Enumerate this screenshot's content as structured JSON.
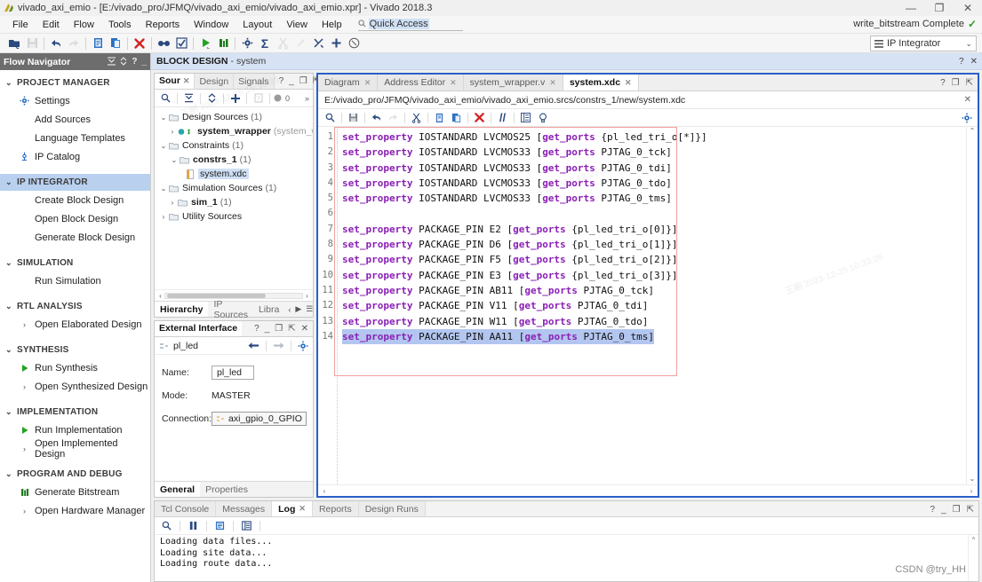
{
  "window": {
    "title": "vivado_axi_emio - [E:/vivado_pro/JFMQ/vivado_axi_emio/vivado_axi_emio.xpr] - Vivado 2018.3",
    "minimize": "—",
    "maximize": "❐",
    "close": "✕"
  },
  "menu": {
    "items": [
      "File",
      "Edit",
      "Flow",
      "Tools",
      "Reports",
      "Window",
      "Layout",
      "View",
      "Help"
    ],
    "quick_access_placeholder": "Quick Access",
    "quick_access_value": "Quick Access",
    "search_icon": "search-icon"
  },
  "status": {
    "text": "write_bitstream Complete",
    "check": "✓",
    "check_color": "#2a9c2a"
  },
  "layout_selector": {
    "value": "IP Integrator",
    "chevron": "⌄",
    "icon": "layout-icon"
  },
  "toolbar": {
    "buttons": [
      {
        "name": "open-project-icon",
        "glyph": "open",
        "disabled": false
      },
      {
        "name": "save-icon",
        "glyph": "save",
        "disabled": true
      },
      {
        "name": "undo-icon",
        "glyph": "undo",
        "disabled": false
      },
      {
        "name": "redo-icon",
        "glyph": "redo",
        "disabled": true
      },
      {
        "name": "copy-icon",
        "glyph": "doc",
        "disabled": false
      },
      {
        "name": "paste-icon",
        "glyph": "paste",
        "disabled": false
      },
      {
        "name": "delete-icon",
        "glyph": "xred",
        "disabled": false
      },
      {
        "name": "search-replace-icon",
        "glyph": "goggles",
        "disabled": false
      },
      {
        "name": "validate-icon",
        "glyph": "check-box",
        "disabled": false
      },
      {
        "name": "run-icon",
        "glyph": "play",
        "disabled": false
      },
      {
        "name": "report-icon",
        "glyph": "bars",
        "disabled": false
      },
      {
        "name": "settings-icon",
        "glyph": "gear",
        "disabled": false
      },
      {
        "name": "sigma-icon",
        "glyph": "sigma",
        "disabled": false
      },
      {
        "name": "cut-icon",
        "glyph": "scissors",
        "disabled": true
      },
      {
        "name": "pencil-icon",
        "glyph": "pencil",
        "disabled": true
      },
      {
        "name": "route-icon",
        "glyph": "route",
        "disabled": false
      },
      {
        "name": "add-icon",
        "glyph": "plus",
        "disabled": false
      },
      {
        "name": "cancel-icon",
        "glyph": "xcircle",
        "disabled": false
      }
    ]
  },
  "flow_navigator": {
    "title": "Flow Navigator",
    "controls": [
      "collapse-all-icon",
      "expand-icon",
      "help-icon",
      "minimize-icon"
    ],
    "groups": [
      {
        "label": "PROJECT MANAGER",
        "selected": false,
        "chevron": "⌄",
        "items": [
          {
            "label": "Settings",
            "icon": "gear-icon"
          },
          {
            "label": "Add Sources",
            "icon": "none"
          },
          {
            "label": "Language Templates",
            "icon": "none"
          },
          {
            "label": "IP Catalog",
            "icon": "ip-catalog-icon"
          }
        ]
      },
      {
        "label": "IP INTEGRATOR",
        "selected": true,
        "chevron": "⌄",
        "items": [
          {
            "label": "Create Block Design",
            "icon": "none"
          },
          {
            "label": "Open Block Design",
            "icon": "none"
          },
          {
            "label": "Generate Block Design",
            "icon": "none"
          }
        ]
      },
      {
        "label": "SIMULATION",
        "selected": false,
        "chevron": "⌄",
        "items": [
          {
            "label": "Run Simulation",
            "icon": "none"
          }
        ]
      },
      {
        "label": "RTL ANALYSIS",
        "selected": false,
        "chevron": "⌄",
        "items": [
          {
            "label": "Open Elaborated Design",
            "icon": "chevron-right-icon"
          }
        ]
      },
      {
        "label": "SYNTHESIS",
        "selected": false,
        "chevron": "⌄",
        "items": [
          {
            "label": "Run Synthesis",
            "icon": "play-icon"
          },
          {
            "label": "Open Synthesized Design",
            "icon": "chevron-right-icon"
          }
        ]
      },
      {
        "label": "IMPLEMENTATION",
        "selected": false,
        "chevron": "⌄",
        "items": [
          {
            "label": "Run Implementation",
            "icon": "play-icon"
          },
          {
            "label": "Open Implemented Design",
            "icon": "chevron-right-icon"
          }
        ]
      },
      {
        "label": "PROGRAM AND DEBUG",
        "selected": false,
        "chevron": "⌄",
        "items": [
          {
            "label": "Generate Bitstream",
            "icon": "bitstream-icon"
          },
          {
            "label": "Open Hardware Manager",
            "icon": "chevron-right-icon"
          }
        ]
      }
    ]
  },
  "block_design_header": {
    "prefix": "BLOCK DESIGN",
    "separator": " - ",
    "name": "system",
    "controls": [
      "help-icon",
      "close-icon"
    ]
  },
  "sources_panel": {
    "tabs": [
      {
        "label": "Sour",
        "active": true,
        "closable": true
      },
      {
        "label": "Design",
        "active": false,
        "closable": false
      },
      {
        "label": "Signals",
        "active": false,
        "closable": false
      }
    ],
    "controls": [
      "help-icon",
      "minimize-icon",
      "maximize-icon",
      "float-icon"
    ],
    "toolbar": [
      {
        "name": "search-icon",
        "glyph": "search"
      },
      {
        "name": "collapse-all-icon",
        "glyph": "collapse"
      },
      {
        "name": "expand-all-icon",
        "glyph": "expand"
      },
      {
        "name": "add-sources-icon",
        "glyph": "plus"
      },
      {
        "name": "report-icon",
        "glyph": "sqdoc"
      },
      {
        "name": "error-count-icon",
        "glyph": "dot"
      }
    ],
    "error_count": "0",
    "overflow": "»",
    "tree": [
      {
        "indent": 0,
        "arrow": "⌄",
        "folder": true,
        "label": "Design Sources",
        "count": "(1)",
        "bold": false,
        "selected": false,
        "dim": ""
      },
      {
        "indent": 1,
        "arrow": "›",
        "folder": false,
        "label": "system_wrapper",
        "count": "",
        "bold": true,
        "selected": false,
        "dim": "(system_wra",
        "bullets": true
      },
      {
        "indent": 0,
        "arrow": "⌄",
        "folder": true,
        "label": "Constraints",
        "count": "(1)",
        "bold": false,
        "selected": false,
        "dim": ""
      },
      {
        "indent": 1,
        "arrow": "⌄",
        "folder": true,
        "label": "constrs_1",
        "count": "(1)",
        "bold": true,
        "selected": false,
        "dim": ""
      },
      {
        "indent": 2,
        "arrow": "",
        "folder": false,
        "label": "system.xdc",
        "count": "",
        "bold": false,
        "selected": true,
        "dim": "",
        "filedoc": true
      },
      {
        "indent": 0,
        "arrow": "⌄",
        "folder": true,
        "label": "Simulation Sources",
        "count": "(1)",
        "bold": false,
        "selected": false,
        "dim": ""
      },
      {
        "indent": 1,
        "arrow": "›",
        "folder": true,
        "label": "sim_1",
        "count": "(1)",
        "bold": true,
        "selected": false,
        "dim": ""
      },
      {
        "indent": 0,
        "arrow": "›",
        "folder": true,
        "label": "Utility Sources",
        "count": "",
        "bold": false,
        "selected": false,
        "dim": ""
      }
    ],
    "bottom_tabs": [
      {
        "label": "Hierarchy",
        "active": true
      },
      {
        "label": "IP Sources",
        "active": false
      },
      {
        "label": "Libra",
        "active": false
      }
    ],
    "bottom_nav": [
      "‹",
      "▶",
      "☰"
    ]
  },
  "external_interface": {
    "title": "External Interface",
    "controls": [
      "help-icon",
      "minimize-icon",
      "maximize-icon",
      "float-icon",
      "close-icon"
    ],
    "subject": "pl_led",
    "subject_icon": "interface-icon",
    "nav": [
      "back-arrow-icon",
      "forward-arrow-icon",
      "gear-icon"
    ],
    "fields": [
      {
        "key": "Name:",
        "value": "pl_led",
        "type": "input"
      },
      {
        "key": "Mode:",
        "value": "MASTER",
        "type": "text"
      },
      {
        "key": "Connection:",
        "value": "axi_gpio_0_GPIO",
        "type": "chip"
      }
    ],
    "bottom_tabs": [
      {
        "label": "General",
        "active": true
      },
      {
        "label": "Properties",
        "active": false
      }
    ]
  },
  "editor": {
    "tabs": [
      {
        "label": "Diagram",
        "active": false,
        "closable": true
      },
      {
        "label": "Address Editor",
        "active": false,
        "closable": true
      },
      {
        "label": "system_wrapper.v",
        "active": false,
        "closable": true
      },
      {
        "label": "system.xdc",
        "active": true,
        "closable": true
      }
    ],
    "controls": [
      "help-icon",
      "maximize-icon",
      "float-icon"
    ],
    "file_path": "E:/vivado_pro/JFMQ/vivado_axi_emio/vivado_axi_emio.srcs/constrs_1/new/system.xdc",
    "path_close": "✕",
    "toolbar": [
      {
        "name": "find-icon",
        "glyph": "search"
      },
      {
        "name": "save-file-icon",
        "glyph": "save"
      },
      {
        "name": "undo-icon",
        "glyph": "undo"
      },
      {
        "name": "redo-icon",
        "glyph": "redo"
      },
      {
        "name": "cut-icon",
        "glyph": "scissors"
      },
      {
        "name": "copy-icon",
        "glyph": "doc"
      },
      {
        "name": "paste-icon",
        "glyph": "paste"
      },
      {
        "name": "delete-icon",
        "glyph": "xred"
      },
      {
        "name": "comment-icon",
        "glyph": "slashes"
      },
      {
        "name": "indent-icon",
        "glyph": "indent"
      },
      {
        "name": "bulb-icon",
        "glyph": "bulb"
      }
    ],
    "gear": "gear-icon",
    "code_lines": [
      {
        "n": 1,
        "kw": "set_property",
        "mid": " IOSTANDARD LVCMOS25 [",
        "kw2": "get_ports",
        "tail": " {pl_led_tri_o[*]}]",
        "selected": false
      },
      {
        "n": 2,
        "kw": "set_property",
        "mid": " IOSTANDARD LVCMOS33 [",
        "kw2": "get_ports",
        "tail": " PJTAG_0_tck]",
        "selected": false
      },
      {
        "n": 3,
        "kw": "set_property",
        "mid": " IOSTANDARD LVCMOS33 [",
        "kw2": "get_ports",
        "tail": " PJTAG_0_tdi]",
        "selected": false
      },
      {
        "n": 4,
        "kw": "set_property",
        "mid": " IOSTANDARD LVCMOS33 [",
        "kw2": "get_ports",
        "tail": " PJTAG_0_tdo]",
        "selected": false
      },
      {
        "n": 5,
        "kw": "set_property",
        "mid": " IOSTANDARD LVCMOS33 [",
        "kw2": "get_ports",
        "tail": " PJTAG_0_tms]",
        "selected": false
      },
      {
        "n": 6,
        "kw": "",
        "mid": "",
        "kw2": "",
        "tail": "",
        "selected": false
      },
      {
        "n": 7,
        "kw": "set_property",
        "mid": " PACKAGE_PIN E2 [",
        "kw2": "get_ports",
        "tail": " {pl_led_tri_o[0]}]",
        "selected": false
      },
      {
        "n": 8,
        "kw": "set_property",
        "mid": " PACKAGE_PIN D6 [",
        "kw2": "get_ports",
        "tail": " {pl_led_tri_o[1]}]",
        "selected": false
      },
      {
        "n": 9,
        "kw": "set_property",
        "mid": " PACKAGE_PIN F5 [",
        "kw2": "get_ports",
        "tail": " {pl_led_tri_o[2]}]",
        "selected": false
      },
      {
        "n": 10,
        "kw": "set_property",
        "mid": " PACKAGE_PIN E3 [",
        "kw2": "get_ports",
        "tail": " {pl_led_tri_o[3]}]",
        "selected": false
      },
      {
        "n": 11,
        "kw": "set_property",
        "mid": " PACKAGE_PIN AB11 [",
        "kw2": "get_ports",
        "tail": " PJTAG_0_tck]",
        "selected": false
      },
      {
        "n": 12,
        "kw": "set_property",
        "mid": " PACKAGE_PIN V11 [",
        "kw2": "get_ports",
        "tail": " PJTAG_0_tdi]",
        "selected": false
      },
      {
        "n": 13,
        "kw": "set_property",
        "mid": " PACKAGE_PIN W11 [",
        "kw2": "get_ports",
        "tail": " PJTAG_0_tdo]",
        "selected": false
      },
      {
        "n": 14,
        "kw": "set_property",
        "mid": " PACKAGE_PIN AA11 [",
        "kw2": "get_ports",
        "tail": " PJTAG_0_tms]",
        "selected": true
      }
    ]
  },
  "console": {
    "tabs": [
      {
        "label": "Tcl Console",
        "active": false,
        "closable": false
      },
      {
        "label": "Messages",
        "active": false,
        "closable": false
      },
      {
        "label": "Log",
        "active": true,
        "closable": true
      },
      {
        "label": "Reports",
        "active": false,
        "closable": false
      },
      {
        "label": "Design Runs",
        "active": false,
        "closable": false
      }
    ],
    "controls": [
      "help-icon",
      "minimize-icon",
      "maximize-icon",
      "float-icon"
    ],
    "toolbar": [
      {
        "name": "search-icon",
        "glyph": "search"
      },
      {
        "name": "pause-icon",
        "glyph": "pause"
      },
      {
        "name": "wrap-icon",
        "glyph": "sqdoc"
      },
      {
        "name": "columns-icon",
        "glyph": "cols"
      }
    ],
    "log_lines": [
      "Loading data files...",
      "Loading site data...",
      "Loading route data..."
    ]
  },
  "watermark": {
    "credit": "CSDN @try_HH",
    "stamps": [
      "王朝 2023-12-25 10:33:26",
      "王朝 2023-12-25 10:33:26",
      "王朝 2023-12-25 10:33:26"
    ]
  },
  "colors": {
    "accent_blue": "#2a5fc9",
    "selection_blue": "#b9d0ef",
    "keyword_purple": "#8b1fb5",
    "error_red": "#d42222",
    "ok_green": "#2a9c2a",
    "header_gray": "#6d6d6d",
    "bd_header": "#d7e3f4"
  }
}
